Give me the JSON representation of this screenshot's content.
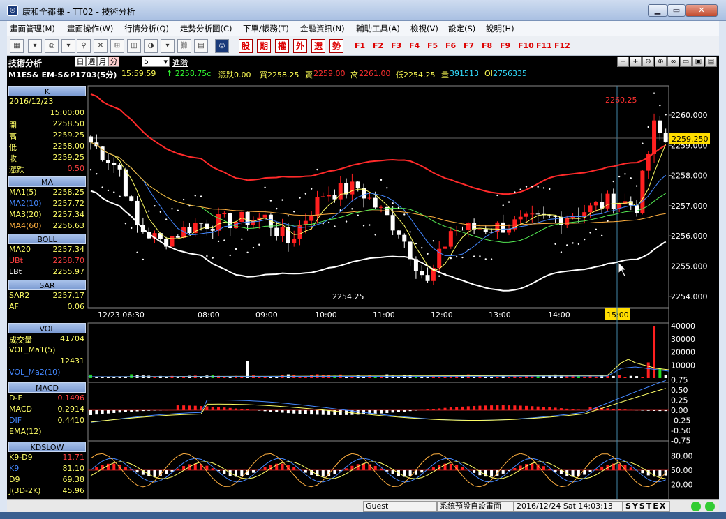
{
  "window": {
    "title": "康和全都賺 - TT02 - 技術分析",
    "app_icon": "app-logo-icon",
    "buttons": [
      "minimize-icon",
      "maximize-icon",
      "close-icon"
    ]
  },
  "menu": [
    "畫面管理(M)",
    "畫面操作(W)",
    "行情分析(Q)",
    "走勢分析圖(C)",
    "下單/帳務(T)",
    "金融資訊(N)",
    "輔助工具(A)",
    "檢視(V)",
    "設定(S)",
    "說明(H)"
  ],
  "toolbar": {
    "red_buttons": [
      "股",
      "期",
      "權",
      "外",
      "選",
      "勢"
    ],
    "fkeys": [
      "F1",
      "F2",
      "F3",
      "F4",
      "F5",
      "F6",
      "F7",
      "F8",
      "F9",
      "F10",
      "F11",
      "F12"
    ]
  },
  "header": {
    "title": "技術分析",
    "periods": [
      "日",
      "週",
      "月",
      "分"
    ],
    "minutes": "5",
    "advanced": "進階"
  },
  "quote": {
    "symbol": "M1ES& EM-S&P1703(5分)",
    "time": "15:59:59",
    "last": "↑ 2258.75c",
    "change": "漲跌0.00",
    "bid": "買2258.25",
    "ask_label": "賣",
    "ask": "2259.00",
    "high_label": "高",
    "high": "2261.00",
    "low": "低2254.25",
    "vol_label": "量",
    "vol": "391513",
    "oi_label": "OI",
    "oi": "2756335"
  },
  "side": {
    "k": {
      "title": "K",
      "date": "2016/12/23",
      "time": "15:00:00",
      "rows": [
        [
          "開",
          "2258.50"
        ],
        [
          "高",
          "2259.25"
        ],
        [
          "低",
          "2258.00"
        ],
        [
          "收",
          "2259.25"
        ],
        [
          "漲跌",
          "0.50"
        ]
      ]
    },
    "ma": {
      "title": "MA",
      "rows": [
        [
          "MA1(5)",
          "2258.25"
        ],
        [
          "MA2(10)",
          "2257.72"
        ],
        [
          "MA3(20)",
          "2257.34"
        ],
        [
          "MA4(60)",
          "2256.63"
        ]
      ]
    },
    "boll": {
      "title": "BOLL",
      "rows": [
        [
          "MA20",
          "2257.34"
        ],
        [
          "UBt",
          "2258.70"
        ],
        [
          "LBt",
          "2255.97"
        ]
      ]
    },
    "sar": {
      "title": "SAR",
      "rows": [
        [
          "SAR2",
          "2257.17"
        ],
        [
          "AF",
          "0.06"
        ]
      ]
    },
    "vol": {
      "title": "VOL",
      "rows": [
        [
          "成交量",
          "41704"
        ],
        [
          "VOL_Ma1(5)",
          ""
        ],
        [
          "",
          "12431"
        ],
        [
          "VOL_Ma2(10)",
          ""
        ]
      ]
    },
    "macd": {
      "title": "MACD",
      "rows": [
        [
          "D-F",
          "0.1496"
        ],
        [
          "MACD",
          "0.2914"
        ],
        [
          "DIF",
          "0.4410"
        ],
        [
          "EMA(12)",
          ""
        ]
      ]
    },
    "kd": {
      "title": "KDSLOW",
      "rows": [
        [
          "K9-D9",
          "11.71"
        ],
        [
          "K9",
          "81.10"
        ],
        [
          "D9",
          "69.38"
        ],
        [
          "J(3D-2K)",
          "45.96"
        ]
      ]
    }
  },
  "chart_data": [
    {
      "type": "candlestick",
      "y_ticks": [
        "2260.000",
        "2259.000",
        "2258.000",
        "2257.000",
        "2256.000",
        "2255.000",
        "2254.000"
      ],
      "x_labels": [
        "12/23 06:30",
        "08:00",
        "09:00",
        "10:00",
        "11:00",
        "12:00",
        "13:00",
        "14:00",
        "15:00"
      ],
      "price_tag": "2259.250",
      "annotations": [
        "2260.25",
        "2254.25"
      ],
      "colors": {
        "up": "#ff2020",
        "down": "#ffffff",
        "upper_band": "#ff2a2a",
        "lower_band": "#ffffff",
        "ma_short": "#ffff66",
        "ma_mid": "#4488ff",
        "ma_long": "#ffb040",
        "sar": "#ffffff"
      }
    },
    {
      "type": "bar",
      "y_ticks": [
        "40000",
        "30000",
        "20000",
        "10000"
      ]
    },
    {
      "type": "line",
      "y_ticks": [
        "0.75",
        "0.50",
        "0.25",
        "0.00",
        "-0.25",
        "-0.50",
        "-0.75"
      ]
    },
    {
      "type": "line",
      "y_ticks": [
        "80.00",
        "50.00",
        "20.00"
      ]
    }
  ],
  "status": {
    "user": "Guest",
    "screen": "系統預設自設畫面",
    "datetime": "2016/12/24 Sat 14:03:13",
    "brand": "SYSTEX"
  }
}
